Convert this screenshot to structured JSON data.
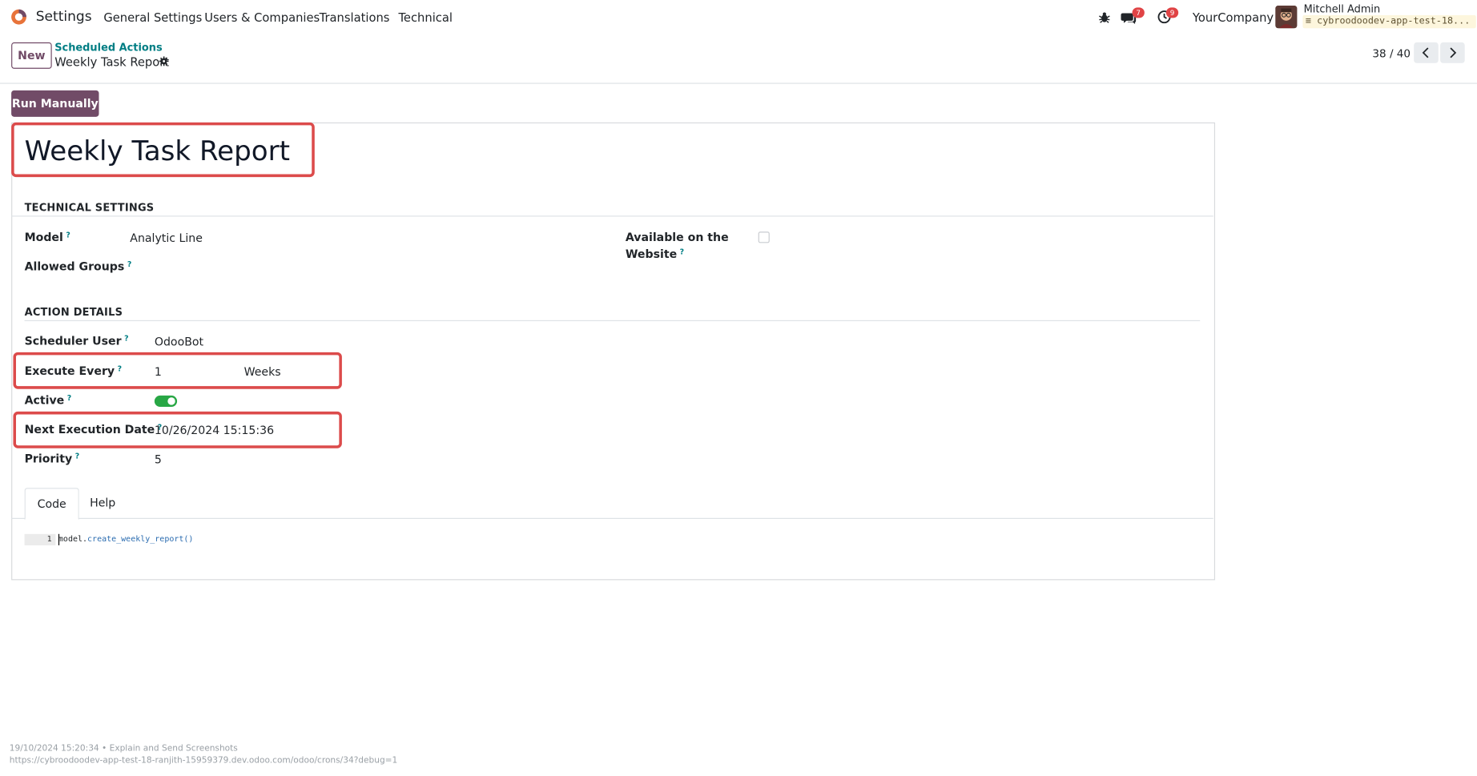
{
  "app": {
    "name": "Settings"
  },
  "menu": [
    "General Settings",
    "Users & Companies",
    "Translations",
    "Technical"
  ],
  "systray": {
    "debug_icon": "bug-icon",
    "messages_icon": "chat-icon",
    "messages_badge": "7",
    "activity_icon": "clock-icon",
    "activity_badge": "9",
    "company": "YourCompany",
    "user_name": "Mitchell Admin",
    "db_name": "cybroodoodev-app-test-18..."
  },
  "control_panel": {
    "new_label": "New",
    "breadcrumb_parent": "Scheduled Actions",
    "breadcrumb_current": "Weekly Task Report",
    "pager": "38 / 40"
  },
  "actions": {
    "run_manually": "Run Manually"
  },
  "record": {
    "title": "Weekly Task Report"
  },
  "technical_settings": {
    "title": "TECHNICAL SETTINGS",
    "model_label": "Model",
    "model_value": "Analytic Line",
    "allowed_groups_label": "Allowed Groups",
    "website_label_line1": "Available on the",
    "website_label_line2": "Website",
    "website_checked": false
  },
  "action_details": {
    "title": "ACTION DETAILS",
    "scheduler_user_label": "Scheduler User",
    "scheduler_user_value": "OdooBot",
    "execute_every_label": "Execute Every",
    "interval_number": "1",
    "interval_type": "Weeks",
    "active_label": "Active",
    "active": true,
    "next_exec_label": "Next Execution Date",
    "next_exec_value": "10/26/2024 15:15:36",
    "priority_label": "Priority",
    "priority_value": "5"
  },
  "help_marker": "?",
  "tabs": [
    "Code",
    "Help"
  ],
  "code": {
    "line_number": "1",
    "object": "model",
    "dot": ".",
    "method": "create_weekly_report()"
  },
  "footer": {
    "line1": "19/10/2024 15:20:34 • Explain and Send Screenshots",
    "line2": "https://cybroodoodev-app-test-18-ranjith-15959379.dev.odoo.com/odoo/crons/34?debug=1"
  },
  "colors": {
    "brand": "#714b67",
    "link": "#017e84",
    "highlight": "#dc4b4b",
    "toggle_on": "#28a745",
    "badge": "#e04345"
  }
}
